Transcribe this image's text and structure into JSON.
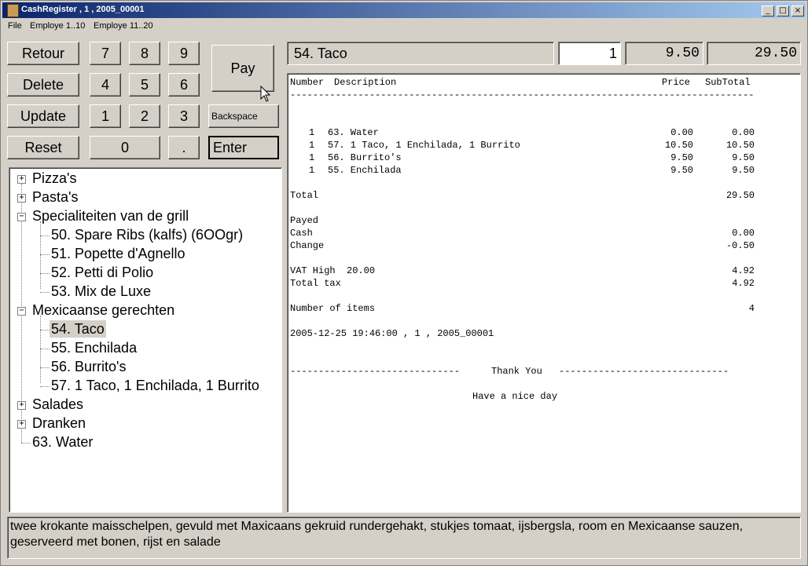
{
  "window": {
    "title": "CashRegister , 1 , 2005_00001",
    "min": "_",
    "max": "□",
    "close": "×"
  },
  "menu": [
    "File",
    "Employe 1..10",
    "Employe 11..20"
  ],
  "buttons": {
    "retour": "Retour",
    "delete": "Delete",
    "update": "Update",
    "reset": "Reset",
    "pay": "Pay",
    "backspace": "Backspace",
    "enter": "Enter",
    "keys": [
      "7",
      "8",
      "9",
      "4",
      "5",
      "6",
      "1",
      "2",
      "3",
      "0",
      "."
    ]
  },
  "display": {
    "item": "54. Taco",
    "qty": "1",
    "price": "9.50",
    "total": "29.50"
  },
  "tree": {
    "nodes": [
      {
        "label": "Pizza's",
        "expander": "+"
      },
      {
        "label": "Pasta's",
        "expander": "+"
      },
      {
        "label": "Specialiteiten van de grill",
        "expander": "−"
      },
      {
        "label": "50. Spare Ribs (kalfs) (6OOgr)"
      },
      {
        "label": "51. Popette d'Agnello"
      },
      {
        "label": "52. Petti di Polio"
      },
      {
        "label": "53. Mix de Luxe"
      },
      {
        "label": "Mexicaanse gerechten",
        "expander": "−"
      },
      {
        "label": "54. Taco",
        "selected": true
      },
      {
        "label": "55. Enchilada"
      },
      {
        "label": "56. Burrito's"
      },
      {
        "label": "57. 1 Taco, 1 Enchilada, 1 Burrito"
      },
      {
        "label": "Salades",
        "expander": "+"
      },
      {
        "label": "Dranken",
        "expander": "+"
      },
      {
        "label": "63. Water"
      }
    ]
  },
  "receipt": {
    "header": {
      "number": "Number",
      "description": "Description",
      "price": "Price",
      "subtotal": "SubTotal"
    },
    "separator": "----------------------------------------------------------------------------------",
    "items": [
      {
        "qty": "1",
        "desc": "63. Water",
        "price": "0.00",
        "sub": "0.00"
      },
      {
        "qty": "1",
        "desc": "57. 1 Taco, 1 Enchilada, 1 Burrito",
        "price": "10.50",
        "sub": "10.50"
      },
      {
        "qty": "1",
        "desc": "56. Burrito's",
        "price": "9.50",
        "sub": "9.50"
      },
      {
        "qty": "1",
        "desc": "55. Enchilada",
        "price": "9.50",
        "sub": "9.50"
      }
    ],
    "total_label": "Total",
    "total": "29.50",
    "payed_label": "Payed",
    "cash_label": "Cash",
    "cash": "0.00",
    "change_label": "Change",
    "change": "-0.50",
    "vat_label": "VAT High  20.00",
    "vat": "4.92",
    "totaltax_label": "Total tax",
    "totaltax": "4.92",
    "numitems_label": "Number of items",
    "numitems": "4",
    "timestamp": "2005-12-25 19:46:00 , 1 , 2005_00001",
    "dashes": "------------------------------",
    "thanks": "Thank You",
    "goodbye": "Have a nice day"
  },
  "description": "twee krokante maisschelpen, gevuld met Maxicaans gekruid rundergehakt, stukjes tomaat, ijsbergsla, room en Mexicaanse sauzen, geserveerd met bonen, rijst en salade"
}
